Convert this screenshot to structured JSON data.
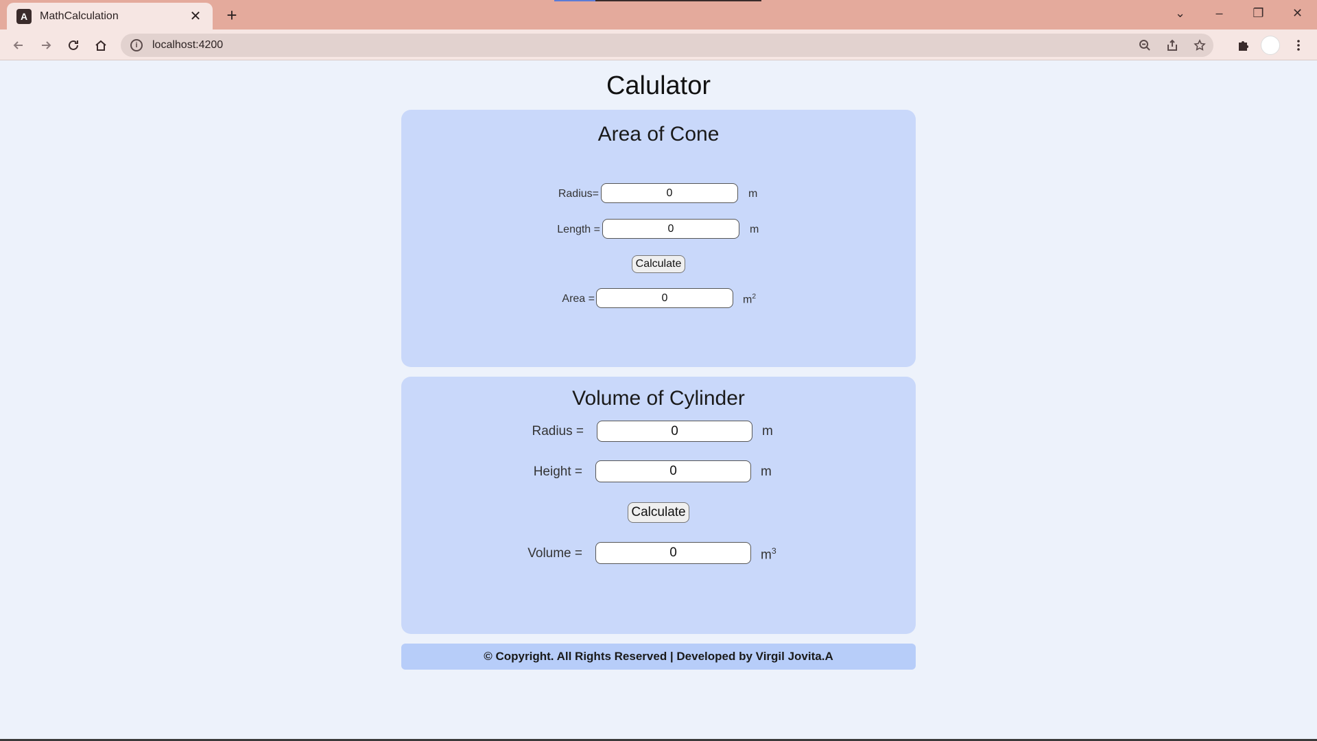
{
  "browser": {
    "tab_title": "MathCalculation",
    "tab_favicon": "A",
    "url": "localhost:4200",
    "icons": {
      "back": "arrow-left-icon",
      "forward": "arrow-right-icon",
      "reload": "reload-icon",
      "home": "home-icon",
      "zoom": "zoom-out-icon",
      "share": "share-icon",
      "bookmark": "star-icon",
      "extensions": "puzzle-icon",
      "menu": "kebab-menu-icon"
    }
  },
  "page": {
    "title": "Calulator"
  },
  "cone": {
    "title": "Area of Cone",
    "radius_label": "Radius=",
    "radius_value": "0",
    "radius_unit": "m",
    "length_label": "Length =",
    "length_value": "0",
    "length_unit": "m",
    "calculate_label": "Calculate",
    "area_label": "Area =",
    "area_value": "0",
    "area_unit_base": "m",
    "area_unit_exp": "2"
  },
  "cylinder": {
    "title": "Volume of Cylinder",
    "radius_label": "Radius =",
    "radius_value": "0",
    "radius_unit": "m",
    "height_label": "Height =",
    "height_value": "0",
    "height_unit": "m",
    "calculate_label": "Calculate",
    "volume_label": "Volume =",
    "volume_value": "0",
    "volume_unit_base": "m",
    "volume_unit_exp": "3"
  },
  "footer": {
    "text": "© Copyright. All Rights Reserved | Developed by Virgil Jovita.A"
  },
  "colors": {
    "page_bg": "#edf2fb",
    "card_bg": "#c9d8fa",
    "footer_bg": "#b7cdf9",
    "tabstrip_bg": "#e4aa9c"
  }
}
